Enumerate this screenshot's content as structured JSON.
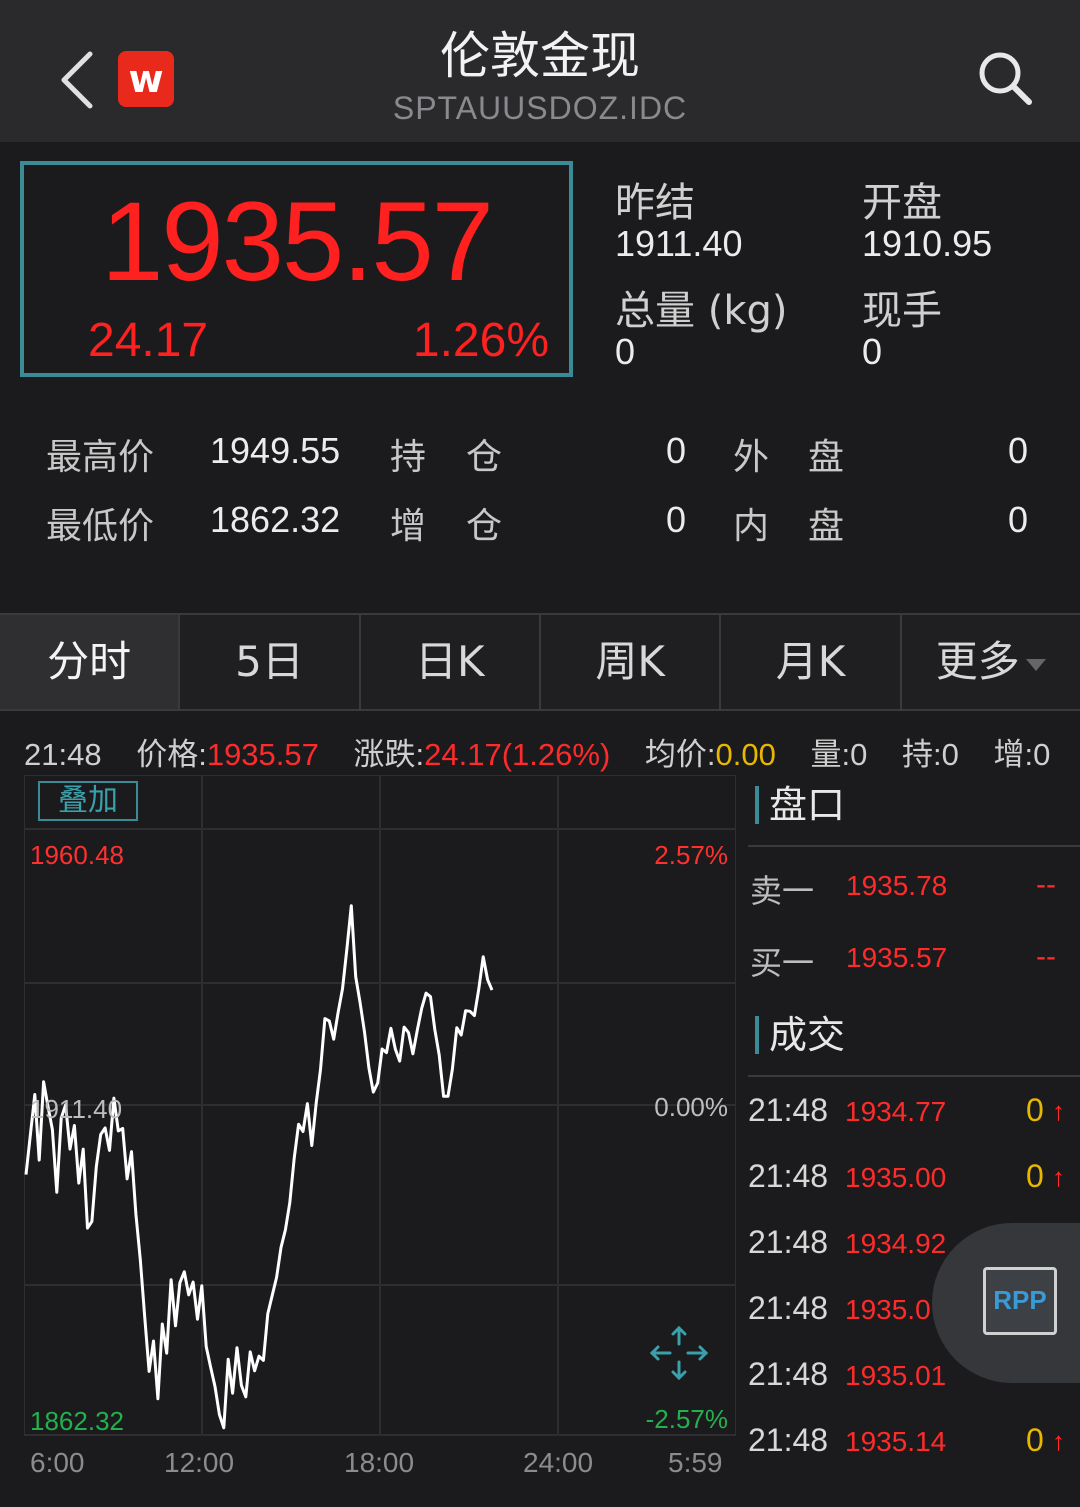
{
  "header": {
    "title": "伦敦金现",
    "subtitle": "SPTAUUSDOZ.IDC",
    "logo_text": "w",
    "back_icon": "chevron-left-icon",
    "search_icon": "search-icon"
  },
  "quote": {
    "price": "1935.57",
    "change": "24.17",
    "change_pct": "1.26%"
  },
  "stats": {
    "prev_settle_label": "昨结",
    "prev_settle_value": "1911.40",
    "open_label": "开盘",
    "open_value": "1910.95",
    "volume_label": "总量 (kg)",
    "volume_value": "0",
    "current_hand_label": "现手",
    "current_hand_value": "0"
  },
  "details": {
    "high_label": "最高价",
    "high_value": "1949.55",
    "low_label": "最低价",
    "low_value": "1862.32",
    "oi_label_1": "持",
    "oi_label_2": "仓",
    "oi_value": "0",
    "oi_add_label_1": "增",
    "oi_add_label_2": "仓",
    "oi_add_value": "0",
    "outer_label_1": "外",
    "outer_label_2": "盘",
    "outer_value": "0",
    "inner_label_1": "内",
    "inner_label_2": "盘",
    "inner_value": "0"
  },
  "tabs": [
    {
      "label": "分时"
    },
    {
      "label": "5日"
    },
    {
      "label": "日K"
    },
    {
      "label": "周K"
    },
    {
      "label": "月K"
    },
    {
      "label": "更多"
    }
  ],
  "info_bar": {
    "time": "21:48",
    "price_label": "价格:",
    "price_value": "1935.57",
    "change_label": "涨跌:",
    "change_value": "24.17(1.26%)",
    "avg_label": "均价:",
    "avg_value": "0.00",
    "vol_label": "量:0",
    "hold_label": "持:0",
    "add_label": "增:0"
  },
  "chart_overlay_button": "叠加",
  "chart_data": {
    "type": "line",
    "y_top_label": "1960.48",
    "y_mid_label": "1911.40",
    "y_bottom_label": "1862.32",
    "pct_top_label": "2.57%",
    "pct_mid_label": "0.00%",
    "pct_bottom_label": "-2.57%",
    "x_tick_labels": [
      "6:00",
      "12:00",
      "18:00",
      "24:00",
      "5:59"
    ],
    "ylim": [
      1862.32,
      1960.48
    ],
    "grid": true,
    "series": [
      {
        "color": "#ffffff",
        "values": [
          1905.2,
          1911.8,
          1918.4,
          1907.6,
          1920.5,
          1916.4,
          1912.6,
          1902.3,
          1914.5,
          1916.7,
          1909.4,
          1913.3,
          1903.8,
          1909.4,
          1896.4,
          1897.5,
          1906.5,
          1911.8,
          1912.9,
          1909.2,
          1917.8,
          1912.4,
          1912.8,
          1904.5,
          1909.0,
          1898.7,
          1891.2,
          1881.8,
          1872.8,
          1877.8,
          1868.3,
          1880.6,
          1875.8,
          1887.9,
          1880.3,
          1887.4,
          1889.2,
          1885.4,
          1887.5,
          1881.4,
          1886.9,
          1876.9,
          1873.5,
          1870.3,
          1865.7,
          1863.5,
          1874.8,
          1869.2,
          1876.7,
          1870.5,
          1868.6,
          1876.0,
          1872.9,
          1875.3,
          1874.6,
          1882.3,
          1885.3,
          1888.3,
          1893.2,
          1896.1,
          1900.6,
          1907.9,
          1913.5,
          1912.3,
          1916.9,
          1910.0,
          1917.0,
          1922.5,
          1930.9,
          1930.5,
          1927.5,
          1931.9,
          1935.8,
          1942.4,
          1949.5,
          1937.8,
          1933.5,
          1928.7,
          1922.8,
          1918.8,
          1920.3,
          1925.9,
          1925.3,
          1929.3,
          1925.9,
          1923.9,
          1929.5,
          1928.6,
          1925.1,
          1929.0,
          1932.6,
          1935.1,
          1934.5,
          1929.1,
          1924.9,
          1918.1,
          1918.1,
          1922.6,
          1929.4,
          1928.2,
          1932.2,
          1932.1,
          1931.4,
          1935.8,
          1941.1,
          1937.3,
          1935.6
        ]
      }
    ]
  },
  "panel": {
    "orderbook_title": "盘口",
    "ask_label": "卖一",
    "ask_price": "1935.78",
    "ask_vol": "--",
    "bid_label": "买一",
    "bid_price": "1935.57",
    "bid_vol": "--",
    "trades_title": "成交",
    "trades": [
      {
        "time": "21:48",
        "price": "1934.77",
        "vol": "0",
        "dir": "↑"
      },
      {
        "time": "21:48",
        "price": "1935.00",
        "vol": "0",
        "dir": "↑"
      },
      {
        "time": "21:48",
        "price": "1934.92",
        "vol": "",
        "dir": ""
      },
      {
        "time": "21:48",
        "price": "1935.0",
        "vol": "",
        "dir": ""
      },
      {
        "time": "21:48",
        "price": "1935.01",
        "vol": "",
        "dir": ""
      },
      {
        "time": "21:48",
        "price": "1935.14",
        "vol": "0",
        "dir": "↑"
      }
    ],
    "rpp_label": "RPP"
  },
  "colors": {
    "up": "#ff2020",
    "down": "#22b14c",
    "accent": "#3a8b95",
    "volume": "#e8b700"
  }
}
